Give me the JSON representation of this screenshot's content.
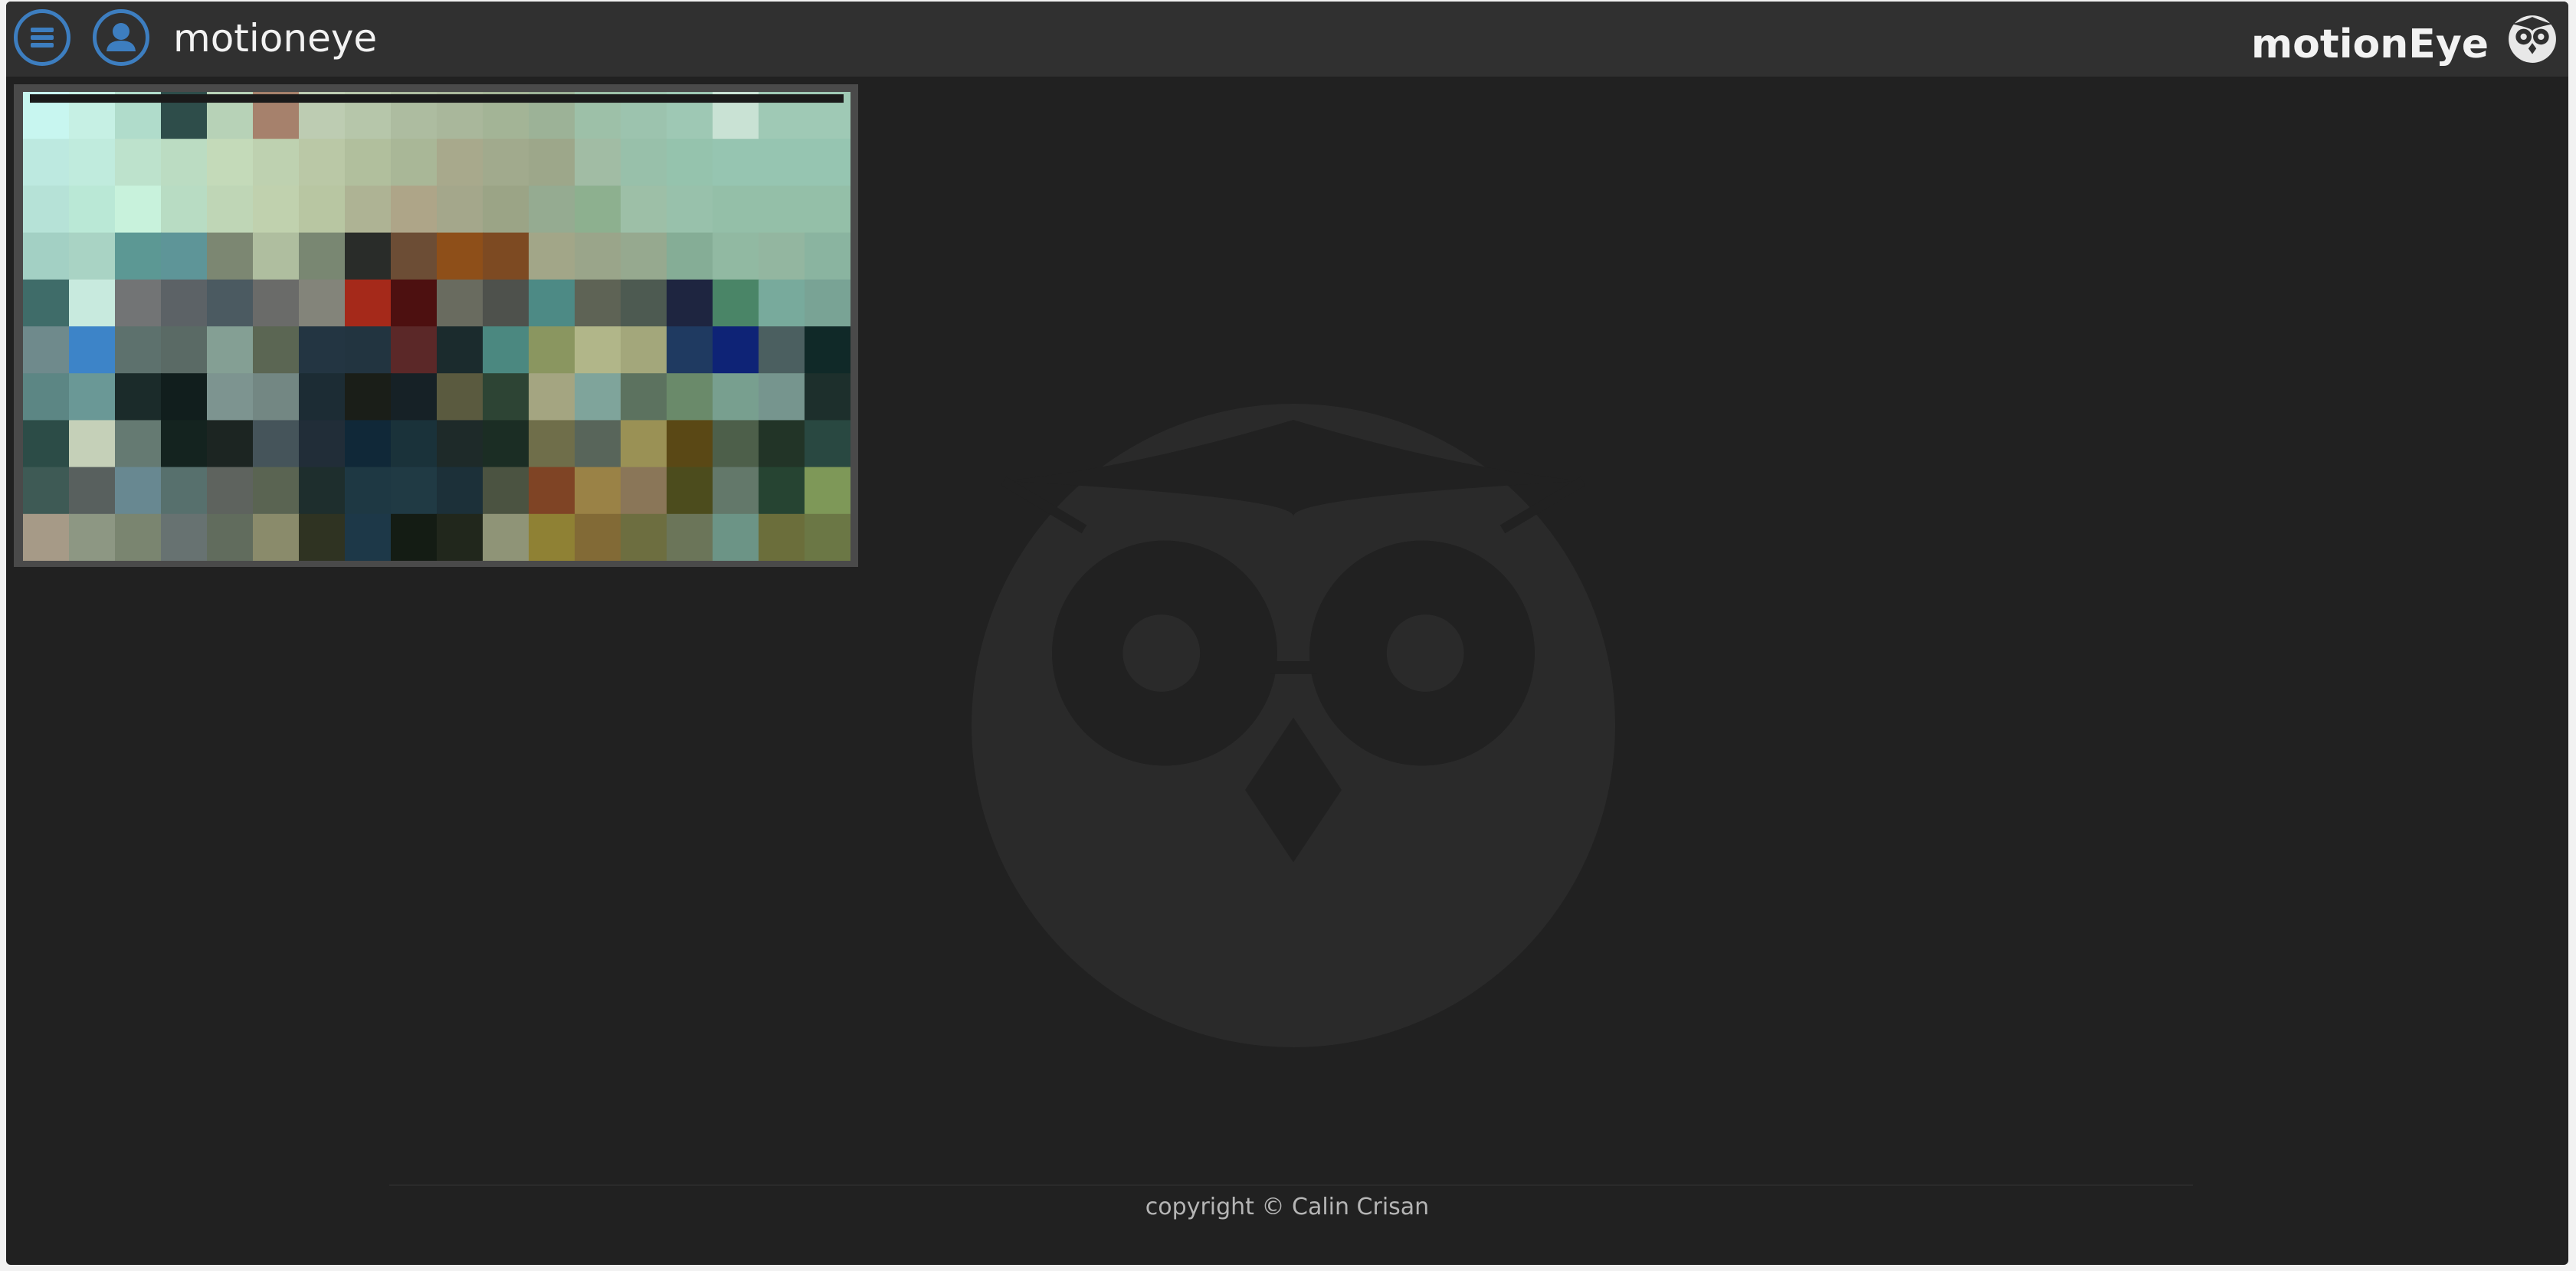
{
  "header": {
    "username": "motioneye",
    "brand": "motionEye",
    "menu_icon": "hamburger-menu-icon",
    "user_icon": "user-icon",
    "logo_icon": "owl-logo-icon"
  },
  "camera": {
    "icon": "camera-frame"
  },
  "footer": {
    "copyright": "copyright © Calin Crisan"
  },
  "colors": {
    "accent": "#3d7ec0",
    "header_bg": "#303030",
    "body_bg": "#212121",
    "text": "#f2f2f2"
  }
}
